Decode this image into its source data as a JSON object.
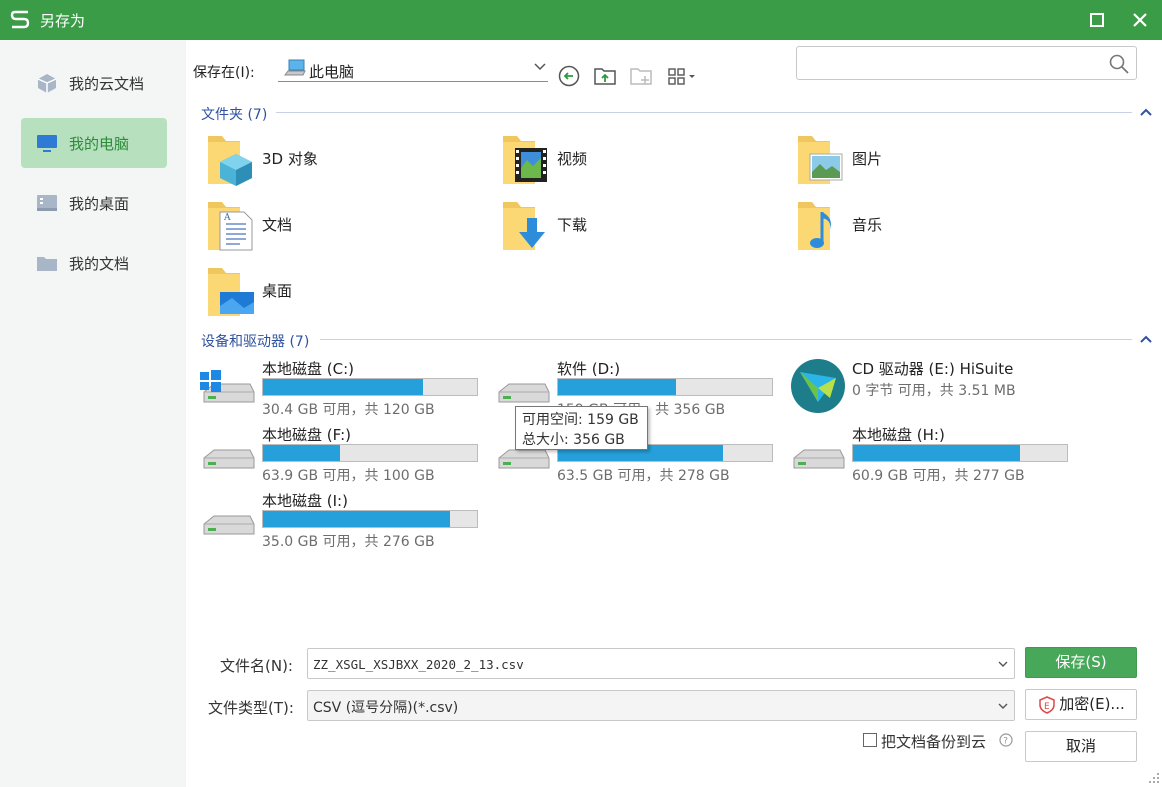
{
  "window": {
    "title": "另存为"
  },
  "sidebar": {
    "items": [
      {
        "label": "我的云文档",
        "icon": "cube-icon",
        "active": false
      },
      {
        "label": "我的电脑",
        "icon": "monitor-icon",
        "active": true
      },
      {
        "label": "我的桌面",
        "icon": "desktop-icon",
        "active": false
      },
      {
        "label": "我的文档",
        "icon": "folder-icon",
        "active": false
      }
    ]
  },
  "toolbar": {
    "save_in_label": "保存在(I):",
    "location": "此电脑",
    "search_placeholder": ""
  },
  "folders": {
    "header": "文件夹 (7)",
    "items": [
      {
        "label": "3D 对象",
        "icon": "3d-objects-folder-icon"
      },
      {
        "label": "视频",
        "icon": "videos-folder-icon"
      },
      {
        "label": "图片",
        "icon": "pictures-folder-icon"
      },
      {
        "label": "文档",
        "icon": "documents-folder-icon"
      },
      {
        "label": "下载",
        "icon": "downloads-folder-icon"
      },
      {
        "label": "音乐",
        "icon": "music-folder-icon"
      },
      {
        "label": "桌面",
        "icon": "desktop-folder-icon"
      }
    ]
  },
  "drives": {
    "header": "设备和驱动器 (7)",
    "items": [
      {
        "name": "本地磁盘 (C:)",
        "info": "30.4 GB 可用，共 120 GB",
        "used_fraction": 0.747
      },
      {
        "name": "软件 (D:)",
        "info": "159 GB 可用，共 356 GB",
        "used_fraction": 0.553
      },
      {
        "name": "CD 驱动器 (E:) HiSuite",
        "info": "0 字节 可用，共 3.51 MB",
        "used_fraction": null
      },
      {
        "name": "本地磁盘 (F:)",
        "info": "63.9 GB 可用，共 100 GB",
        "used_fraction": 0.361
      },
      {
        "name": "",
        "info": "63.5 GB 可用，共 278 GB",
        "used_fraction": 0.772
      },
      {
        "name": "本地磁盘 (H:)",
        "info": "60.9 GB 可用，共 277 GB",
        "used_fraction": 0.78
      },
      {
        "name": "本地磁盘 (I:)",
        "info": "35.0 GB 可用，共 276 GB",
        "used_fraction": 0.873
      }
    ],
    "tooltip": {
      "line1": "可用空间: 159 GB",
      "line2": "总大小: 356 GB"
    }
  },
  "form": {
    "filename_label": "文件名(N):",
    "filename_value": "ZZ_XSGL_XSJBXX_2020_2_13.csv",
    "filetype_label": "文件类型(T):",
    "filetype_value": "CSV (逗号分隔)(*.csv)",
    "save_button": "保存(S)",
    "encrypt_button": "加密(E)...",
    "cancel_button": "取消",
    "backup_label": "把文档备份到云"
  },
  "colors": {
    "titlebar": "#3b9c47",
    "accent": "#48a85a",
    "progress": "#26a0da",
    "section_header": "#2f52a0"
  }
}
